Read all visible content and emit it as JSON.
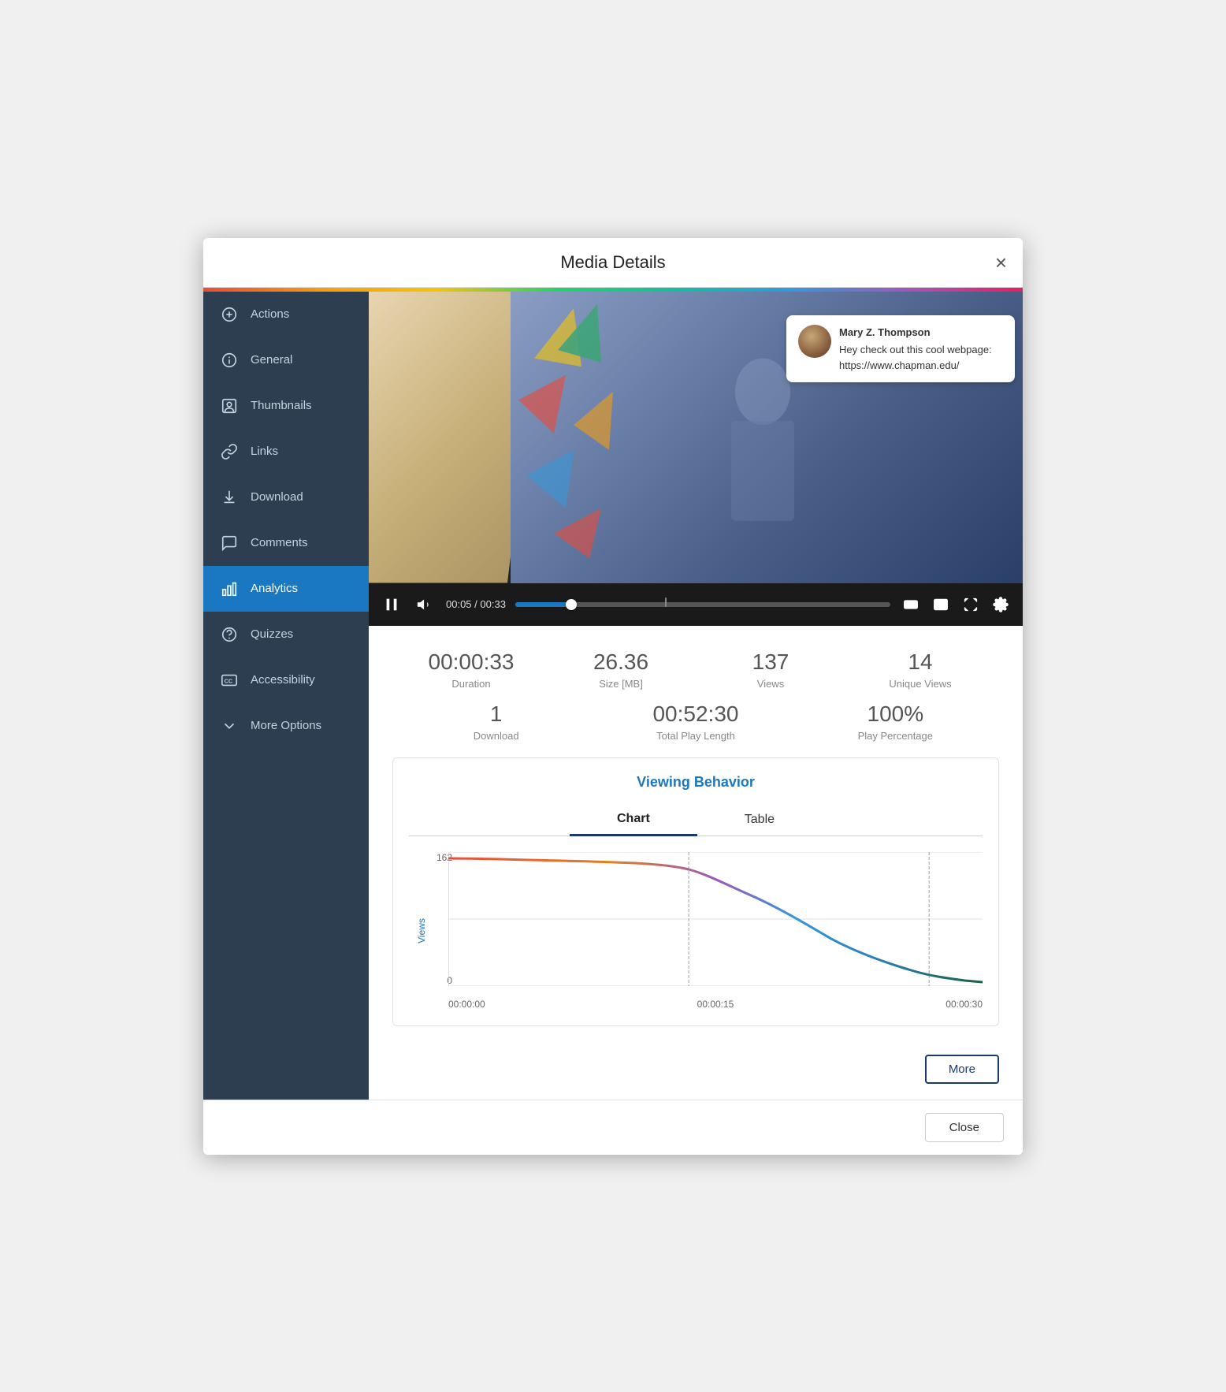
{
  "modal": {
    "title": "Media Details",
    "close_label": "×"
  },
  "sidebar": {
    "items": [
      {
        "id": "actions",
        "label": "Actions",
        "icon": "plus-circle",
        "active": false
      },
      {
        "id": "general",
        "label": "General",
        "icon": "info-circle",
        "active": false
      },
      {
        "id": "thumbnails",
        "label": "Thumbnails",
        "icon": "user-square",
        "active": false
      },
      {
        "id": "links",
        "label": "Links",
        "icon": "link",
        "active": false
      },
      {
        "id": "download",
        "label": "Download",
        "icon": "download",
        "active": false
      },
      {
        "id": "comments",
        "label": "Comments",
        "icon": "message-square",
        "active": false
      },
      {
        "id": "analytics",
        "label": "Analytics",
        "icon": "bar-chart",
        "active": true
      },
      {
        "id": "quizzes",
        "label": "Quizzes",
        "icon": "help-circle",
        "active": false
      },
      {
        "id": "accessibility",
        "label": "Accessibility",
        "icon": "cc",
        "active": false
      },
      {
        "id": "more-options",
        "label": "More Options",
        "icon": "chevron-down",
        "active": false
      }
    ]
  },
  "video": {
    "current_time": "00:05",
    "total_time": "00:33",
    "progress_percent": 15
  },
  "comment": {
    "author": "Mary Z. Thompson",
    "text": "Hey check out this cool webpage: https://www.chapman.edu/"
  },
  "stats": {
    "row1": [
      {
        "value": "00:00:33",
        "label": "Duration"
      },
      {
        "value": "26.36",
        "label": "Size [MB]"
      },
      {
        "value": "137",
        "label": "Views"
      },
      {
        "value": "14",
        "label": "Unique Views"
      }
    ],
    "row2": [
      {
        "value": "1",
        "label": "Download"
      },
      {
        "value": "00:52:30",
        "label": "Total Play Length"
      },
      {
        "value": "100%",
        "label": "Play Percentage"
      }
    ]
  },
  "viewing_behavior": {
    "title": "Viewing Behavior",
    "tabs": [
      {
        "id": "chart",
        "label": "Chart",
        "active": true
      },
      {
        "id": "table",
        "label": "Table",
        "active": false
      }
    ],
    "chart": {
      "y_label": "Views",
      "y_ticks": [
        "162",
        "0"
      ],
      "x_ticks": [
        "00:00:00",
        "00:00:15",
        "00:00:30"
      ],
      "max_views": 162
    }
  },
  "buttons": {
    "more": "More",
    "close": "Close"
  }
}
